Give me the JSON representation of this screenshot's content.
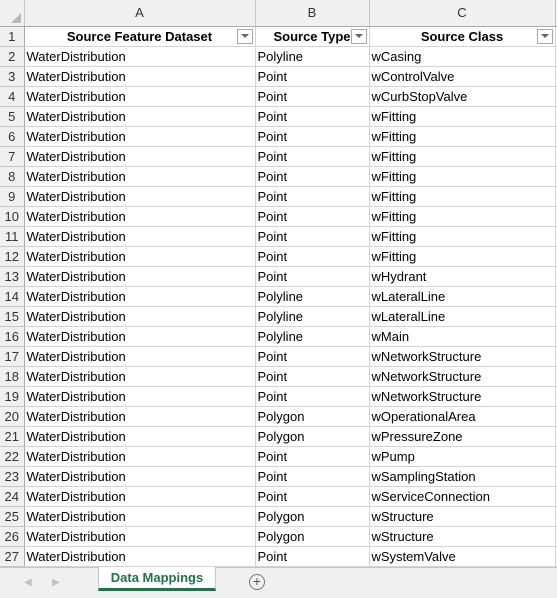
{
  "columns": [
    "A",
    "B",
    "C"
  ],
  "headers": [
    "Source Feature Dataset",
    "Source Type",
    "Source Class"
  ],
  "rows": [
    [
      "WaterDistribution",
      "Polyline",
      "wCasing"
    ],
    [
      "WaterDistribution",
      "Point",
      "wControlValve"
    ],
    [
      "WaterDistribution",
      "Point",
      "wCurbStopValve"
    ],
    [
      "WaterDistribution",
      "Point",
      "wFitting"
    ],
    [
      "WaterDistribution",
      "Point",
      "wFitting"
    ],
    [
      "WaterDistribution",
      "Point",
      "wFitting"
    ],
    [
      "WaterDistribution",
      "Point",
      "wFitting"
    ],
    [
      "WaterDistribution",
      "Point",
      "wFitting"
    ],
    [
      "WaterDistribution",
      "Point",
      "wFitting"
    ],
    [
      "WaterDistribution",
      "Point",
      "wFitting"
    ],
    [
      "WaterDistribution",
      "Point",
      "wFitting"
    ],
    [
      "WaterDistribution",
      "Point",
      "wHydrant"
    ],
    [
      "WaterDistribution",
      "Polyline",
      "wLateralLine"
    ],
    [
      "WaterDistribution",
      "Polyline",
      "wLateralLine"
    ],
    [
      "WaterDistribution",
      "Polyline",
      "wMain"
    ],
    [
      "WaterDistribution",
      "Point",
      "wNetworkStructure"
    ],
    [
      "WaterDistribution",
      "Point",
      "wNetworkStructure"
    ],
    [
      "WaterDistribution",
      "Point",
      "wNetworkStructure"
    ],
    [
      "WaterDistribution",
      "Polygon",
      "wOperationalArea"
    ],
    [
      "WaterDistribution",
      "Polygon",
      "wPressureZone"
    ],
    [
      "WaterDistribution",
      "Point",
      "wPump"
    ],
    [
      "WaterDistribution",
      "Point",
      "wSamplingStation"
    ],
    [
      "WaterDistribution",
      "Point",
      "wServiceConnection"
    ],
    [
      "WaterDistribution",
      "Polygon",
      "wStructure"
    ],
    [
      "WaterDistribution",
      "Polygon",
      "wStructure"
    ],
    [
      "WaterDistribution",
      "Point",
      "wSystemValve"
    ]
  ],
  "sheet_tab": "Data Mappings",
  "accent": "#217346",
  "icons": {
    "prev": "triangle-left-icon",
    "next": "triangle-right-icon",
    "add": "plus-circle-icon",
    "filter": "filter-dropdown-icon"
  }
}
